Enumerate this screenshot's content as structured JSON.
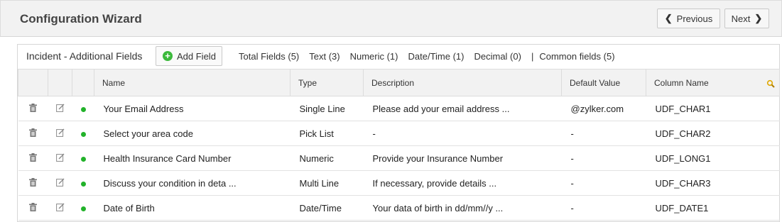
{
  "header": {
    "title": "Configuration Wizard",
    "previous_label": "Previous",
    "next_label": "Next"
  },
  "panel": {
    "title": "Incident - Additional Fields",
    "add_field_label": "Add Field",
    "counts": {
      "total": "Total Fields (5)",
      "text": "Text (3)",
      "numeric": "Numeric (1)",
      "datetime": "Date/Time (1)",
      "decimal": "Decimal (0)",
      "separator": "|",
      "common": "Common fields (5)"
    }
  },
  "table": {
    "headers": {
      "name": "Name",
      "type": "Type",
      "description": "Description",
      "default_value": "Default Value",
      "column_name": "Column Name"
    },
    "rows": [
      {
        "name": "Your Email Address",
        "type": "Single Line",
        "description": "Please add your email address ...",
        "default_value": "@zylker.com",
        "column_name": "UDF_CHAR1"
      },
      {
        "name": "Select your area code",
        "type": "Pick List",
        "description": "-",
        "default_value": "-",
        "column_name": "UDF_CHAR2"
      },
      {
        "name": "Health Insurance Card Number",
        "type": "Numeric",
        "description": "Provide your Insurance Number",
        "default_value": "-",
        "column_name": "UDF_LONG1"
      },
      {
        "name": "Discuss your condition in deta ...",
        "type": "Multi Line",
        "description": "If necessary, provide details ...",
        "default_value": "-",
        "column_name": "UDF_CHAR3"
      },
      {
        "name": "Date of Birth",
        "type": "Date/Time",
        "description": "Your data of birth in dd/mm//y ...",
        "default_value": "-",
        "column_name": "UDF_DATE1"
      }
    ]
  },
  "icons": {
    "delete": "trash-icon",
    "edit": "edit-icon",
    "status": "status-dot-icon",
    "add": "plus-circle-icon",
    "column_search": "search-icon",
    "prev": "chevron-left-icon",
    "next": "chevron-right-icon"
  },
  "colors": {
    "status_active": "#22b22a",
    "add_icon": "#3cb93c",
    "search_icon": "#e0a800"
  }
}
